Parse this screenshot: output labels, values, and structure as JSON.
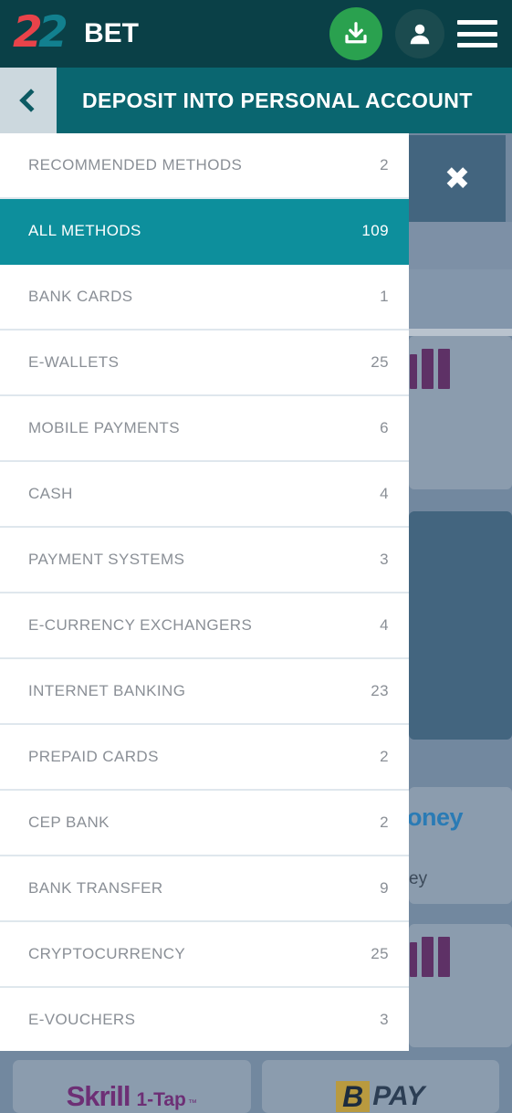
{
  "topnav": {
    "logo": {
      "digit_red": "2",
      "digit_teal": "2",
      "word": "BET"
    },
    "deposit_button_icon": "download-icon",
    "account_button_icon": "person-icon",
    "menu_button_icon": "hamburger-menu-icon"
  },
  "titlebar": {
    "back_icon": "chevron-left-icon",
    "title": "DEPOSIT INTO PERSONAL ACCOUNT"
  },
  "methods_panel": {
    "items": [
      {
        "label": "RECOMMENDED METHODS",
        "count": "2",
        "selected": false
      },
      {
        "label": "ALL METHODS",
        "count": "109",
        "selected": true
      },
      {
        "label": "BANK CARDS",
        "count": "1",
        "selected": false
      },
      {
        "label": "E-WALLETS",
        "count": "25",
        "selected": false
      },
      {
        "label": "MOBILE PAYMENTS",
        "count": "6",
        "selected": false
      },
      {
        "label": "CASH",
        "count": "4",
        "selected": false
      },
      {
        "label": "PAYMENT SYSTEMS",
        "count": "3",
        "selected": false
      },
      {
        "label": "E-CURRENCY EXCHANGERS",
        "count": "4",
        "selected": false
      },
      {
        "label": "INTERNET BANKING",
        "count": "23",
        "selected": false
      },
      {
        "label": "PREPAID CARDS",
        "count": "2",
        "selected": false
      },
      {
        "label": "CEP BANK",
        "count": "2",
        "selected": false
      },
      {
        "label": "BANK TRANSFER",
        "count": "9",
        "selected": false
      },
      {
        "label": "CRYPTOCURRENCY",
        "count": "25",
        "selected": false
      },
      {
        "label": "E-VOUCHERS",
        "count": "3",
        "selected": false
      }
    ]
  },
  "background": {
    "close_button_label": "✖",
    "partial_text_blue": "oney",
    "partial_text_dark": "ey",
    "tiles": [
      {
        "name": "skrill-1-tap",
        "part1": "Skrill",
        "part2": "1-Tap",
        "part3": "™"
      },
      {
        "name": "bpay",
        "part1": "B",
        "part2": "PAY"
      }
    ]
  },
  "colors": {
    "topnav_bg": "#0a4047",
    "titlebar_bg": "#0a6670",
    "selected_row": "#0d8f9c",
    "deposit_green": "#2aa14f",
    "overlay_dim": "#72889f",
    "row_text": "#8a8f96"
  }
}
